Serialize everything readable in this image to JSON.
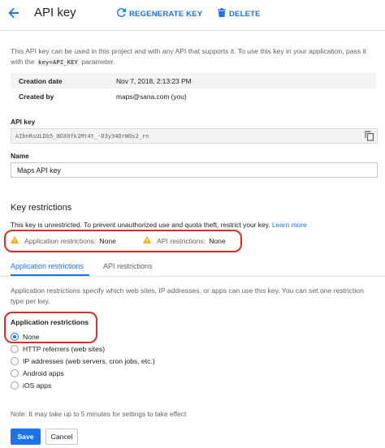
{
  "header": {
    "title": "API key",
    "regenerate_label": "REGENERATE KEY",
    "delete_label": "DELETE"
  },
  "intro": {
    "text_before": "This API key can be used in this project and with any API that supports it. To use this key in your application, pass it with the ",
    "code": "key=API_KEY",
    "text_after": " parameter."
  },
  "info": {
    "rows": [
      {
        "label": "Creation date",
        "value": "Nov 7, 2018, 2:13:23 PM"
      },
      {
        "label": "Created by",
        "value": "maps@sana.com (you)"
      }
    ]
  },
  "api_key": {
    "label": "API key",
    "value": "AIbnRsULDb5_8OX0fk1Mt4t_-D3y34DrWOs2_rn"
  },
  "name": {
    "label": "Name",
    "value": "Maps API key"
  },
  "key_restrictions": {
    "title": "Key restrictions",
    "message": "This key is unrestricted. To prevent unauthorized use and quota theft, restrict your key.",
    "learn_more": "Learn more",
    "warnings": [
      {
        "label": "Application restrictions:",
        "value": "None"
      },
      {
        "label": "API restrictions:",
        "value": "None"
      }
    ]
  },
  "tabs": [
    {
      "label": "Application restrictions",
      "active": true
    },
    {
      "label": "API restrictions",
      "active": false
    }
  ],
  "application_restrictions": {
    "description": "Application restrictions specify which web sites, IP addresses, or apps can use this key. You can set one restriction type per key.",
    "heading": "Application restrictions",
    "options": [
      {
        "label": "None",
        "checked": true
      },
      {
        "label": "HTTP referrers (web sites)",
        "checked": false
      },
      {
        "label": "IP addresses (web servers, cron jobs, etc.)",
        "checked": false
      },
      {
        "label": "Android apps",
        "checked": false
      },
      {
        "label": "iOS apps",
        "checked": false
      }
    ]
  },
  "note": "Note: It may take up to 5 minutes for settings to take effect",
  "actions": {
    "save": "Save",
    "cancel": "Cancel"
  },
  "colors": {
    "accent": "#1a73e8",
    "warning": "#f9ab00",
    "highlight": "#d93025"
  }
}
